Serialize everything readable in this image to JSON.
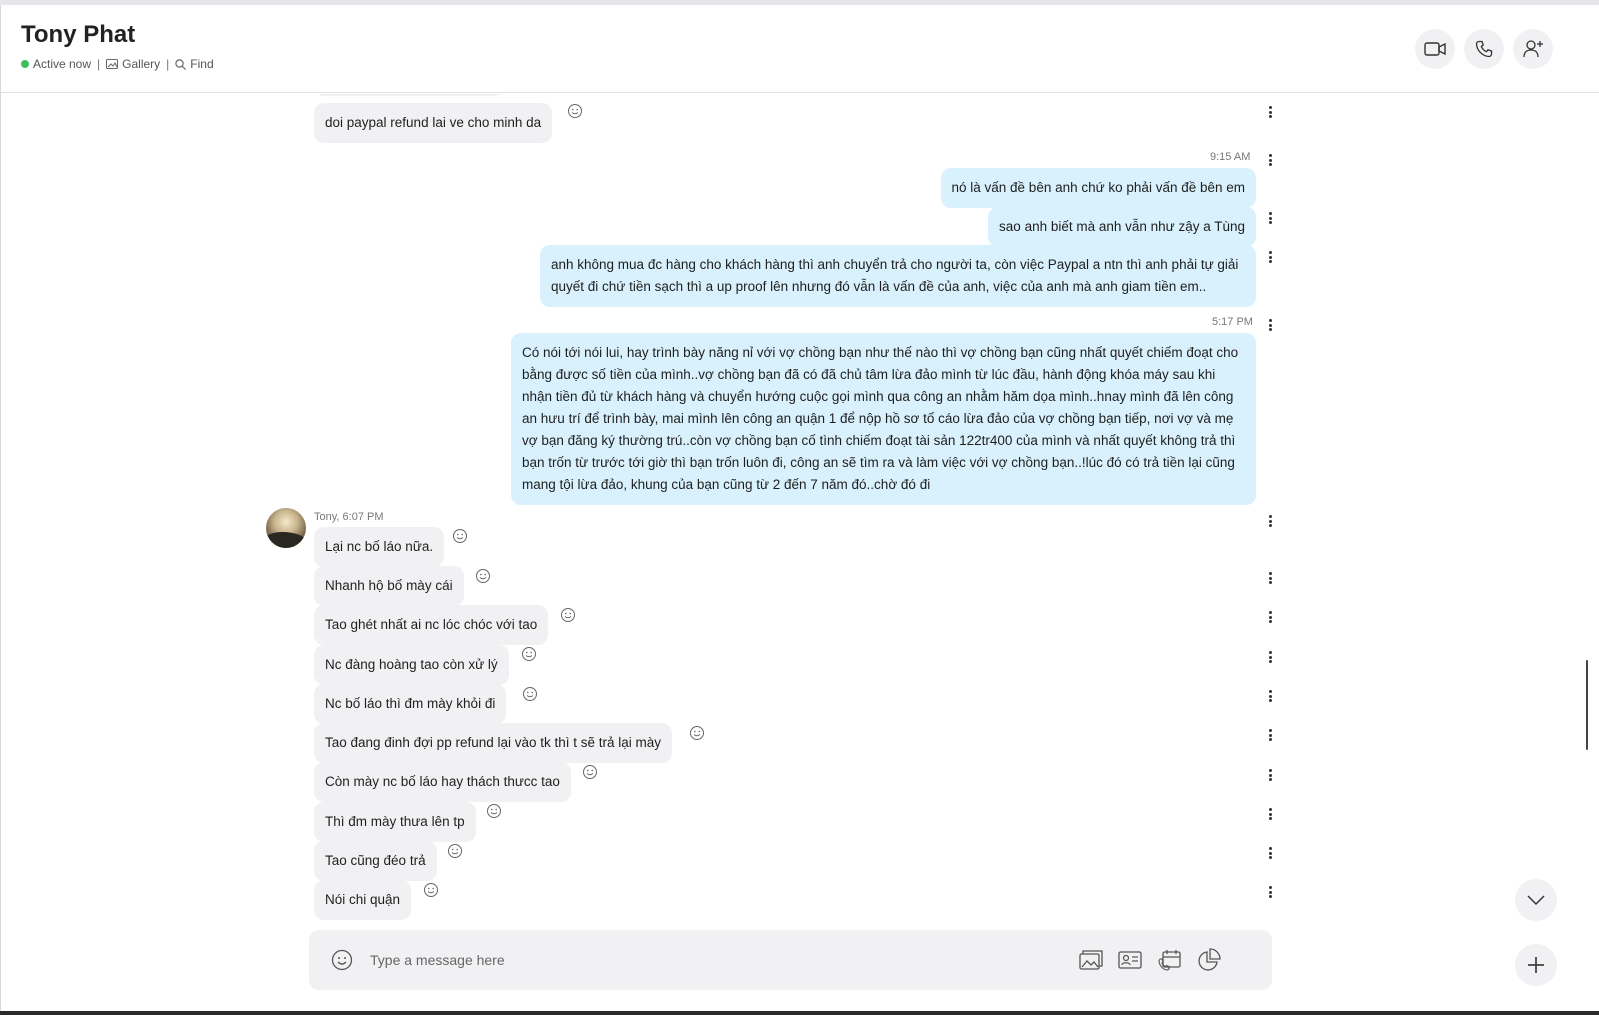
{
  "header": {
    "title": "Tony Phat",
    "status": "Active now",
    "gallery": "Gallery",
    "find": "Find",
    "separator": "|"
  },
  "messages": {
    "m0": "doi paypal refund lai ve cho minh da",
    "t1": "9:15 AM",
    "m1": "nó là vấn đề bên anh chứ ko phải vấn đề bên em",
    "m2": "sao anh biết mà anh vẫn như zậy a Tùng",
    "m3": "anh không mua đc hàng cho khách hàng thì anh chuyển trả cho người ta, còn việc Paypal a ntn thì anh phải tự giải quyết đi chứ tiền sạch thì a up proof lên nhưng đó vẫn là vấn đề của anh, việc của anh mà anh giam tiền em..",
    "t2": "5:17 PM",
    "m4": "Có nói tới nói lui, hay trình bày năng nỉ với vợ chồng bạn như thế nào thì vợ chồng bạn cũng nhất quyết chiếm đoạt cho bằng được số tiền của mình..vợ chồng bạn đã có đã chủ tâm lừa đảo mình từ lúc đầu, hành động khóa máy sau khi nhận tiền đủ từ khách hàng và chuyển hướng cuộc gọi mình qua công an nhằm hăm dọa mình..hnay mình đã lên công an hưu trí để trình bày, mai mình lên công an quận 1 để nộp hồ sơ tố cáo lừa đảo của vợ chồng bạn tiếp, nơi vợ và mẹ vợ bạn đăng ký thường trú..còn vợ chồng bạn cố tình chiếm đoạt tài sản 122tr400 của mình và nhất quyết không trả thì bạn trốn từ trước tới giờ thì bạn trốn luôn đi, công an sẽ tìm ra và làm việc với vợ chồng bạn..!lúc đó có trả tiền lại cũng mang tội lừa đảo, khung của bạn cũng từ 2 đến 7 năm đó..chờ đó đi",
    "sender": "Tony, 6:07 PM",
    "m5": "Lại nc bố láo nữa.",
    "m6": "Nhanh hộ bố mày cái",
    "m7": "Tao ghét nhất ai nc lóc chóc với tao",
    "m8": "Nc đàng hoàng tao còn xử lý",
    "m9": "Nc bố láo thì đm mày khỏi đi",
    "m10": "Tao đang đinh đợi pp refund lại vào tk thì t sẽ trả lại mày",
    "m11": "Còn mày nc bố láo hay thách thưcc tao",
    "m12": "Thì đm mày thưa lên tp",
    "m13": "Tao cũng đéo trả",
    "m14": "Nói chi quận"
  },
  "composer": {
    "placeholder": "Type a message here"
  },
  "colors": {
    "outgoing_bubble": "#d8f1fd",
    "incoming_bubble": "#f1f1f3",
    "online": "#3fbf5b"
  }
}
